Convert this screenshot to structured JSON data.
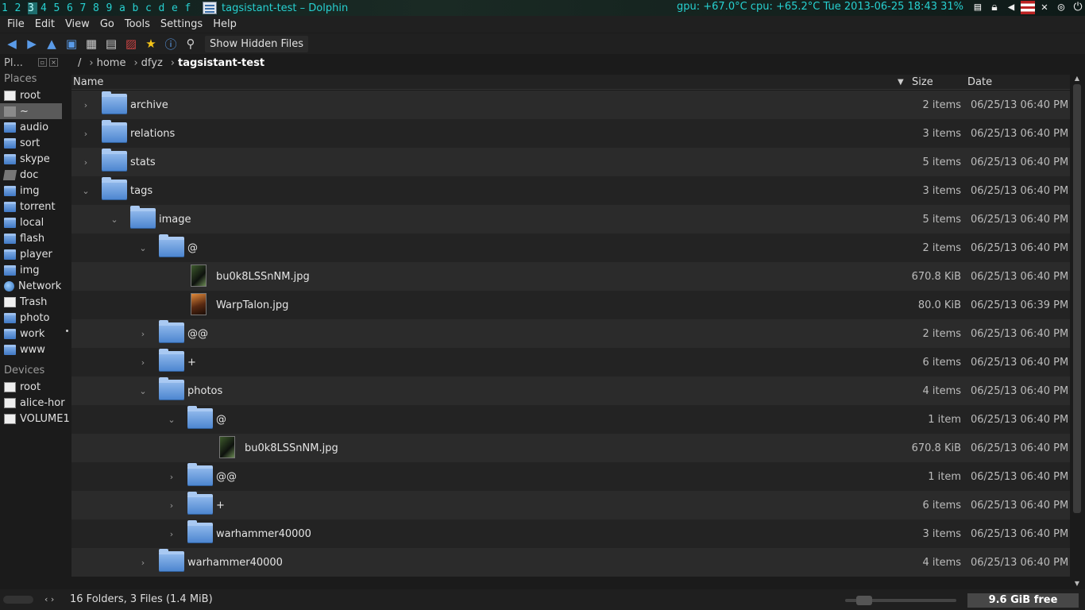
{
  "topbar": {
    "workspaces": [
      "1",
      "2",
      "3",
      "4",
      "5",
      "6",
      "7",
      "8",
      "9",
      "a",
      "b",
      "c",
      "d",
      "e",
      "f"
    ],
    "window_title": "tagsistant-test – Dolphin",
    "sysinfo": "gpu: +67.0°C cpu: +65.2°C  Tue 2013-06-25 18:43 31%"
  },
  "menu": [
    "File",
    "Edit",
    "View",
    "Go",
    "Tools",
    "Settings",
    "Help"
  ],
  "toolbar": {
    "show_hidden_label": "Show Hidden Files"
  },
  "places_panel": {
    "title": "Pl...",
    "sections": {
      "places_title": "Places",
      "devices_title": "Devices"
    },
    "places": [
      {
        "label": "root",
        "icon": "doc"
      },
      {
        "label": "~",
        "icon": "home",
        "selected": true
      },
      {
        "label": "audio",
        "icon": "folder"
      },
      {
        "label": "sort",
        "icon": "folder"
      },
      {
        "label": "skype",
        "icon": "folder"
      },
      {
        "label": "doc",
        "icon": "drive"
      },
      {
        "label": "img",
        "icon": "folder"
      },
      {
        "label": "torrent",
        "icon": "folder"
      },
      {
        "label": "local",
        "icon": "folder"
      },
      {
        "label": "flash",
        "icon": "folder"
      },
      {
        "label": "player",
        "icon": "folder"
      },
      {
        "label": "img",
        "icon": "folder"
      },
      {
        "label": "Network",
        "icon": "globe"
      },
      {
        "label": "Trash",
        "icon": "trash"
      },
      {
        "label": "photo",
        "icon": "folder"
      },
      {
        "label": "work",
        "icon": "folder"
      },
      {
        "label": "www",
        "icon": "folder"
      }
    ],
    "devices": [
      {
        "label": "root",
        "icon": "dev"
      },
      {
        "label": "alice-hor",
        "icon": "dev"
      },
      {
        "label": "VOLUME1",
        "icon": "dev"
      }
    ]
  },
  "breadcrumb": {
    "root": "/",
    "items": [
      "home",
      "dfyz"
    ],
    "current": "tagsistant-test"
  },
  "columns": {
    "name": "Name",
    "size": "Size",
    "date": "Date"
  },
  "rows": [
    {
      "name": "archive",
      "type": "folder",
      "level": 0,
      "expanded": false,
      "size": "2 items",
      "date": "06/25/13 06:40 PM"
    },
    {
      "name": "relations",
      "type": "folder",
      "level": 0,
      "expanded": false,
      "size": "3 items",
      "date": "06/25/13 06:40 PM"
    },
    {
      "name": "stats",
      "type": "folder",
      "level": 0,
      "expanded": false,
      "size": "5 items",
      "date": "06/25/13 06:40 PM"
    },
    {
      "name": "tags",
      "type": "folder",
      "level": 0,
      "expanded": true,
      "size": "3 items",
      "date": "06/25/13 06:40 PM"
    },
    {
      "name": "image",
      "type": "folder",
      "level": 1,
      "expanded": true,
      "size": "5 items",
      "date": "06/25/13 06:40 PM"
    },
    {
      "name": "@",
      "type": "folder",
      "level": 2,
      "expanded": true,
      "size": "2 items",
      "date": "06/25/13 06:40 PM"
    },
    {
      "name": "bu0k8LSSnNM.jpg",
      "type": "img",
      "level": 3,
      "size": "670.8 KiB",
      "date": "06/25/13 06:40 PM"
    },
    {
      "name": "WarpTalon.jpg",
      "type": "img2",
      "level": 3,
      "size": "80.0 KiB",
      "date": "06/25/13 06:39 PM"
    },
    {
      "name": "@@",
      "type": "folder",
      "level": 2,
      "expanded": false,
      "size": "2 items",
      "date": "06/25/13 06:40 PM"
    },
    {
      "name": "+",
      "type": "folder",
      "level": 2,
      "expanded": false,
      "size": "6 items",
      "date": "06/25/13 06:40 PM"
    },
    {
      "name": "photos",
      "type": "folder",
      "level": 2,
      "expanded": true,
      "size": "4 items",
      "date": "06/25/13 06:40 PM"
    },
    {
      "name": "@",
      "type": "folder",
      "level": 3,
      "expanded": true,
      "size": "1 item",
      "date": "06/25/13 06:40 PM"
    },
    {
      "name": "bu0k8LSSnNM.jpg",
      "type": "img",
      "level": 4,
      "size": "670.8 KiB",
      "date": "06/25/13 06:40 PM"
    },
    {
      "name": "@@",
      "type": "folder",
      "level": 3,
      "expanded": false,
      "size": "1 item",
      "date": "06/25/13 06:40 PM"
    },
    {
      "name": "+",
      "type": "folder",
      "level": 3,
      "expanded": false,
      "size": "6 items",
      "date": "06/25/13 06:40 PM"
    },
    {
      "name": "warhammer40000",
      "type": "folder",
      "level": 3,
      "expanded": false,
      "size": "3 items",
      "date": "06/25/13 06:40 PM"
    },
    {
      "name": "warhammer40000",
      "type": "folder",
      "level": 2,
      "expanded": false,
      "size": "4 items",
      "date": "06/25/13 06:40 PM"
    }
  ],
  "status": {
    "summary": "16 Folders, 3 Files (1.4 MiB)",
    "free": "9.6 GiB free"
  }
}
